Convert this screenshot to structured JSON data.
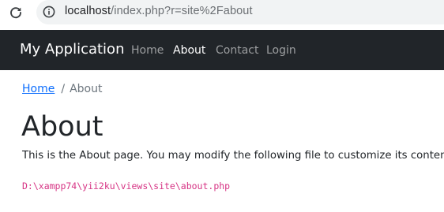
{
  "browser": {
    "url_host": "localhost",
    "url_rest": "/index.php?r=site%2Fabout",
    "reload_icon": "reload-icon",
    "info_icon": "info-icon"
  },
  "navbar": {
    "brand": "My Application",
    "items": [
      {
        "label": "Home",
        "active": false
      },
      {
        "label": "About",
        "active": true
      },
      {
        "label": "Contact",
        "active": false
      },
      {
        "label": "Login",
        "active": false
      }
    ]
  },
  "breadcrumb": {
    "home": "Home",
    "separator": "/",
    "current": "About"
  },
  "main": {
    "title": "About",
    "text": "This is the About page. You may modify the following file to customize its content:",
    "file_path": "D:\\xampp74\\yii2ku\\views\\site\\about.php"
  },
  "colors": {
    "navbar_bg": "#212529",
    "link": "#0d6efd",
    "code": "#d63384"
  }
}
